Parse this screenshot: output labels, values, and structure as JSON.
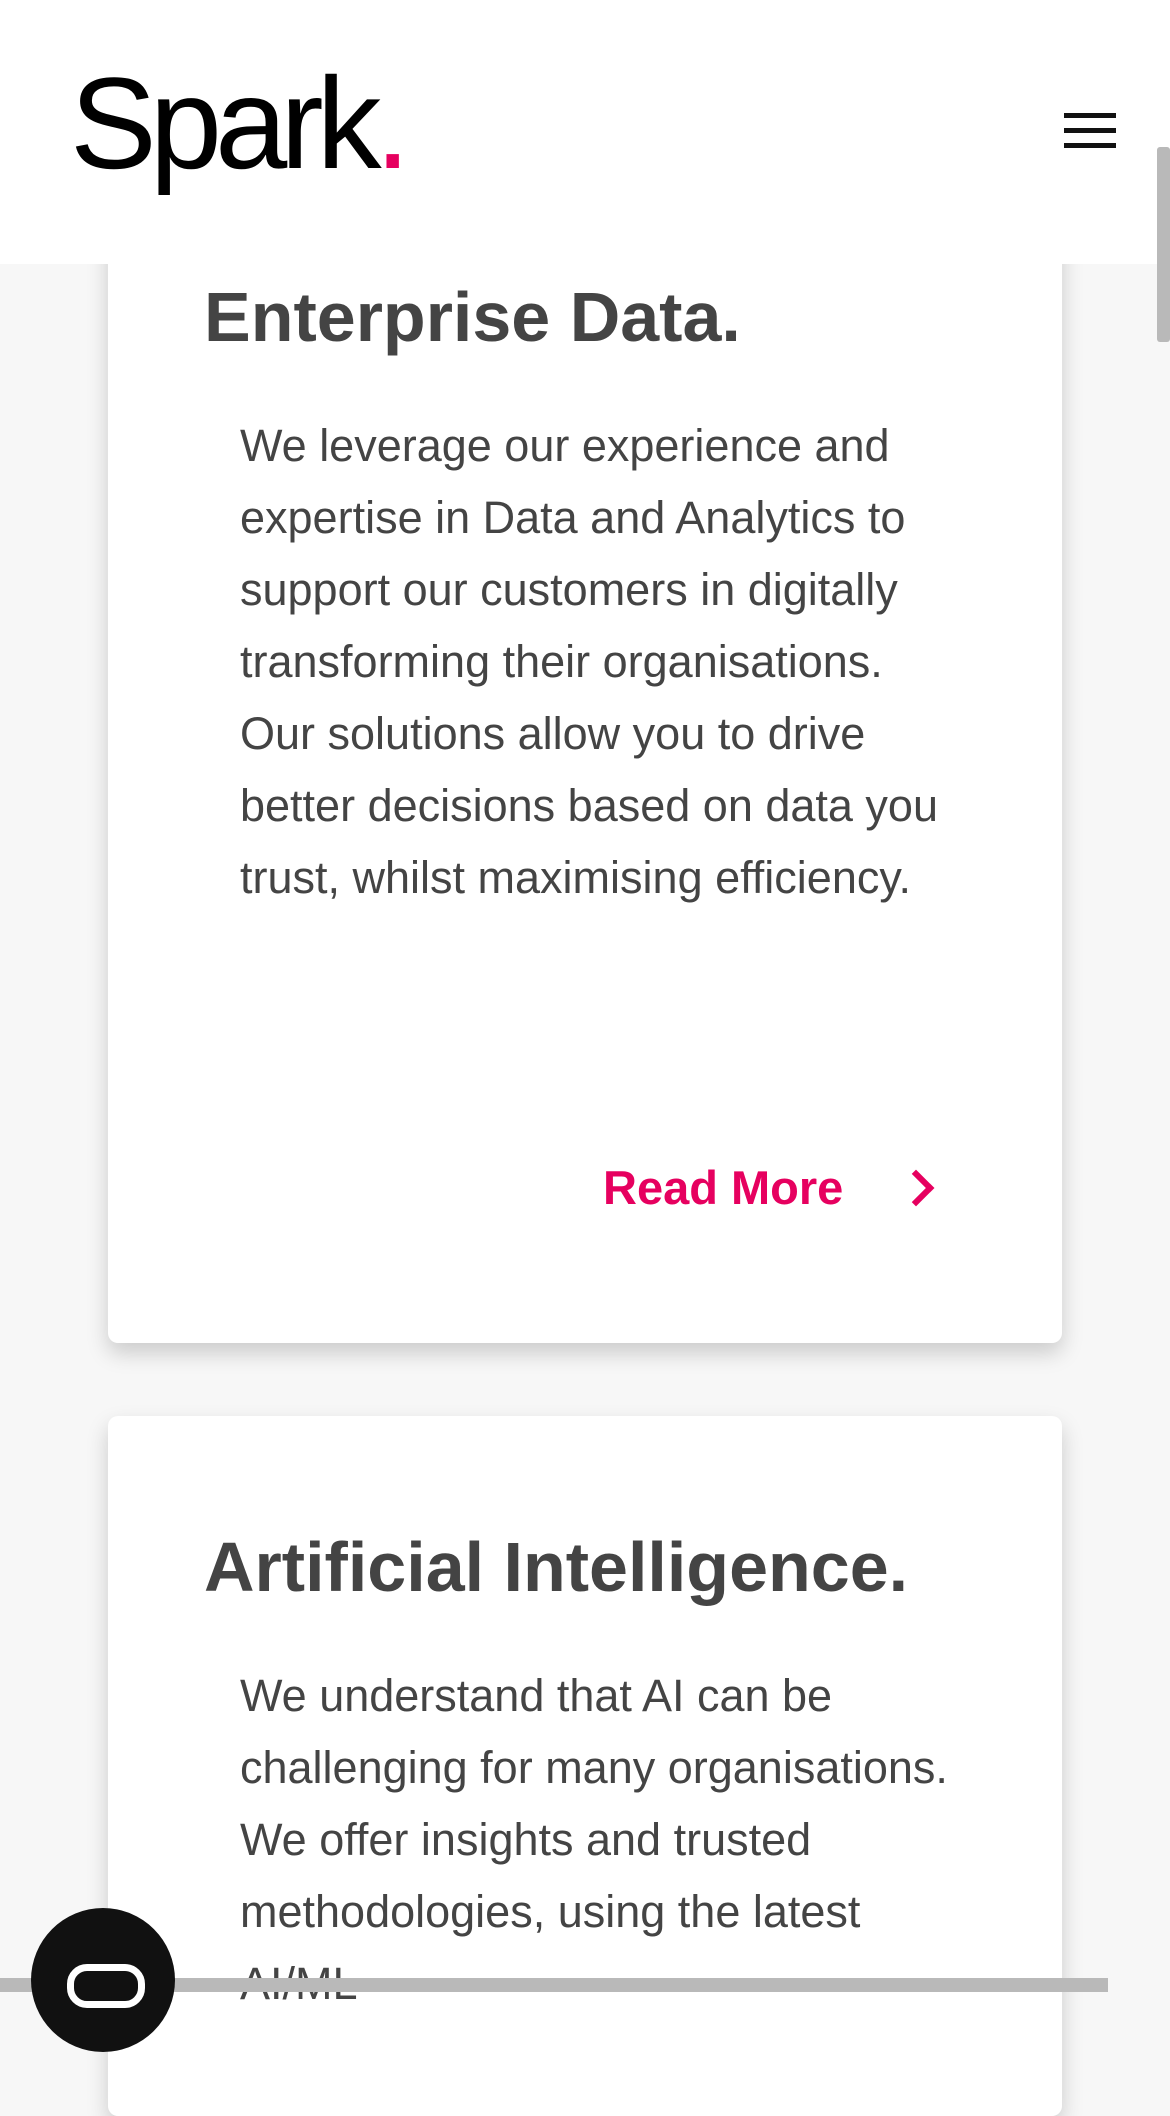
{
  "header": {
    "logo_text": "Spark",
    "logo_dot": ".",
    "menu_icon": "hamburger-menu-icon"
  },
  "colors": {
    "accent": "#e6005f",
    "text": "#444444",
    "logo": "#000000",
    "card_background": "#ffffff",
    "page_background": "#f7f7f7"
  },
  "cards": [
    {
      "title": "Enterprise Data.",
      "text": "We leverage our experience and expertise in Data and Analytics to support our customers in digitally transforming their organisations. Our solutions allow you to drive better decisions based on data you trust, whilst maximising efficiency.",
      "link_label": "Read More",
      "link_icon": "chevron-right-icon"
    },
    {
      "title": "Artificial Intelligence.",
      "text": "We understand that AI can be challenging for many organisations. We offer insights and trusted methodologies, using the latest AI/ML"
    }
  ],
  "chat_widget": {
    "icon": "chat-icon"
  }
}
